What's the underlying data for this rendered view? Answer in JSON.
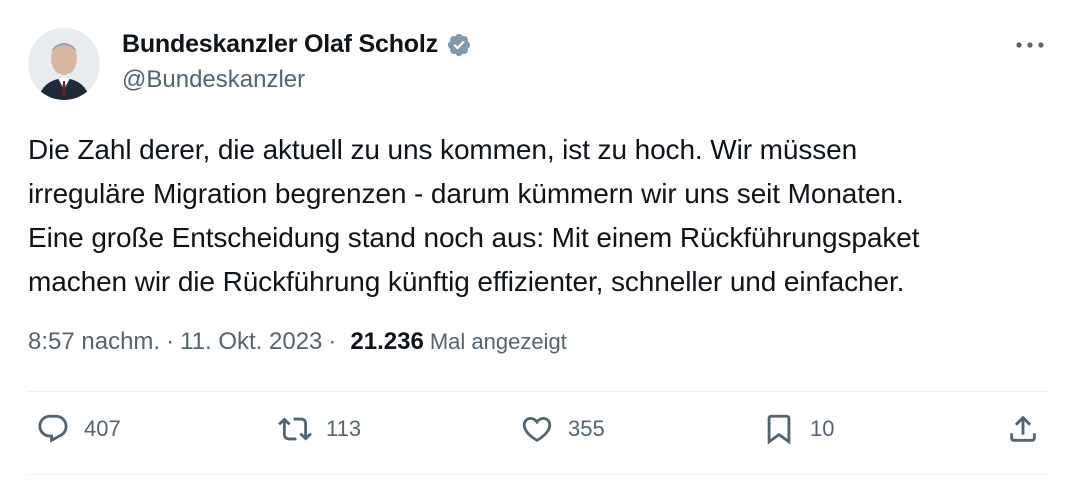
{
  "author": {
    "display_name": "Bundeskanzler Olaf Scholz",
    "handle": "@Bundeskanzler"
  },
  "tweet": {
    "text": "Die Zahl derer, die aktuell zu uns kommen, ist zu hoch. Wir müssen\nirreguläre Migration begrenzen - darum kümmern wir uns seit Monaten.\nEine große Entscheidung stand noch aus: Mit einem Rückführungspaket\nmachen wir die Rückführung künftig effizienter, schneller und einfacher."
  },
  "meta": {
    "time": "8:57 nachm.",
    "sep1": "·",
    "date": "11. Okt. 2023",
    "sep2": "·",
    "views": "21.236",
    "views_label": "Mal angezeigt"
  },
  "actions": {
    "replies": "407",
    "reposts": "113",
    "likes": "355",
    "bookmarks": "10"
  },
  "colors": {
    "text": "#0f1419",
    "muted": "#536471",
    "verified": "#829aab",
    "divider": "#eff3f4"
  },
  "icons": [
    "verified-badge-icon",
    "more-icon",
    "reply-icon",
    "repost-icon",
    "like-icon",
    "bookmark-icon",
    "share-icon"
  ]
}
